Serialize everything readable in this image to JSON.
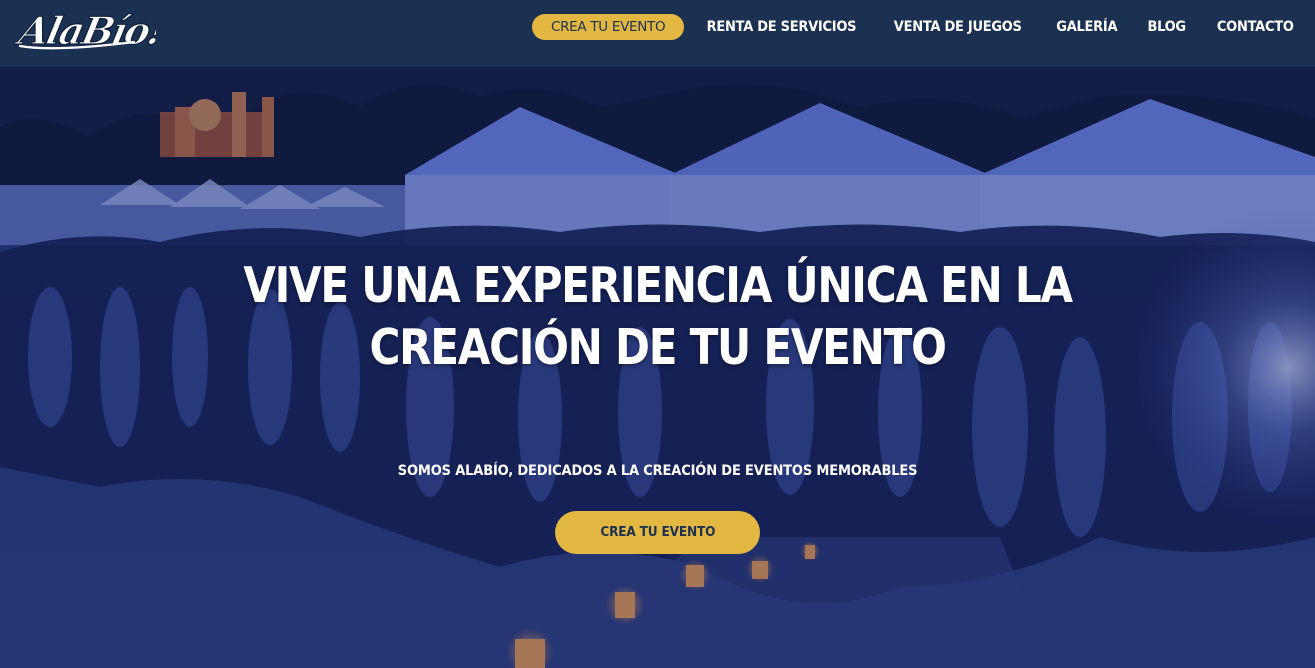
{
  "brand": {
    "logo_text": "AlaBío!"
  },
  "nav": {
    "cta_label": "CREA TU EVENTO",
    "items": [
      {
        "label": "RENTA DE SERVICIOS"
      },
      {
        "label": "VENTA DE JUEGOS"
      },
      {
        "label": "GALERÍA"
      },
      {
        "label": "BLOG"
      },
      {
        "label": "CONTACTO"
      }
    ]
  },
  "hero": {
    "title_line1": "VIVE UNA EXPERIENCIA ÚNICA EN LA",
    "title_line2": "CREACIÓN DE TU EVENTO",
    "subtitle": "SOMOS ALABÍO, DEDICADOS A LA CREACIÓN DE EVENTOS MEMORABLES",
    "button_label": "CREA TU EVENTO"
  },
  "colors": {
    "header_bg": "#1b3152",
    "accent": "#e2b843",
    "hero_tint": "#2a3f8f",
    "text": "#ffffff"
  }
}
